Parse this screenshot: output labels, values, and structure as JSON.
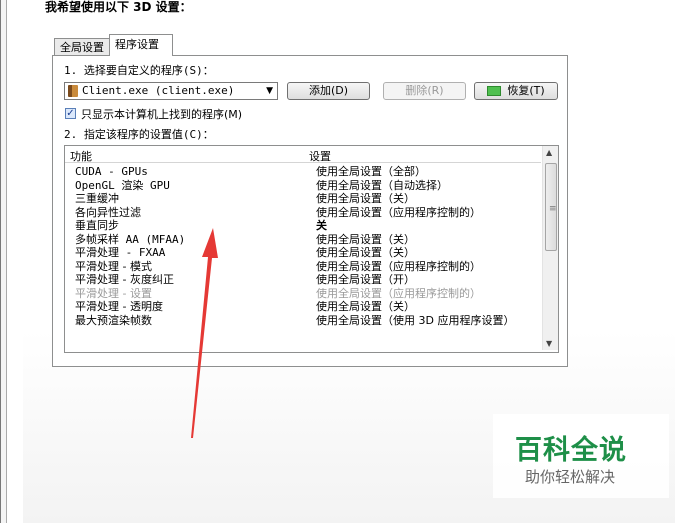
{
  "heading": "我希望使用以下 3D 设置：",
  "tabs": [
    {
      "label": "全局设置",
      "active": false
    },
    {
      "label": "程序设置",
      "active": true
    }
  ],
  "step1_label": "1. 选择要自定义的程序(S)：",
  "program_select": {
    "value": "Client.exe (client.exe)"
  },
  "buttons": {
    "add": "添加(D)",
    "remove": "删除(R)",
    "restore": "恢复(T)"
  },
  "only_show_checkbox": {
    "label": "只显示本计算机上找到的程序(M)",
    "checked": true
  },
  "step2_label": "2. 指定该程序的设置值(C)：",
  "list": {
    "columns": [
      "功能",
      "设置"
    ],
    "rows": [
      {
        "feature": "CUDA - GPUs",
        "value": "使用全局设置（全部）"
      },
      {
        "feature": "OpenGL 渲染 GPU",
        "value": "使用全局设置（自动选择）"
      },
      {
        "feature": "三重缓冲",
        "value": "使用全局设置（关）"
      },
      {
        "feature": "各向异性过滤",
        "value": "使用全局设置（应用程序控制的）"
      },
      {
        "feature": "垂直同步",
        "value": "关"
      },
      {
        "feature": "多帧采样 AA (MFAA)",
        "value": "使用全局设置（关）"
      },
      {
        "feature": "平滑处理 - FXAA",
        "value": "使用全局设置（关）"
      },
      {
        "feature": "平滑处理 - 模式",
        "value": "使用全局设置（应用程序控制的）"
      },
      {
        "feature": "平滑处理 - 灰度纠正",
        "value": "使用全局设置（开）"
      },
      {
        "feature": "平滑处理 - 设置",
        "value": "使用全局设置（应用程序控制的）"
      },
      {
        "feature": "平滑处理 - 透明度",
        "value": "使用全局设置（关）"
      },
      {
        "feature": "最大预渲染帧数",
        "value": "使用全局设置（使用 3D 应用程序设置）"
      }
    ]
  },
  "watermark": {
    "title": "百科全说",
    "subtitle": "助你轻松解决"
  },
  "colors": {
    "watermark_green": "#1e8f48",
    "arrow_red": "#e53935"
  }
}
